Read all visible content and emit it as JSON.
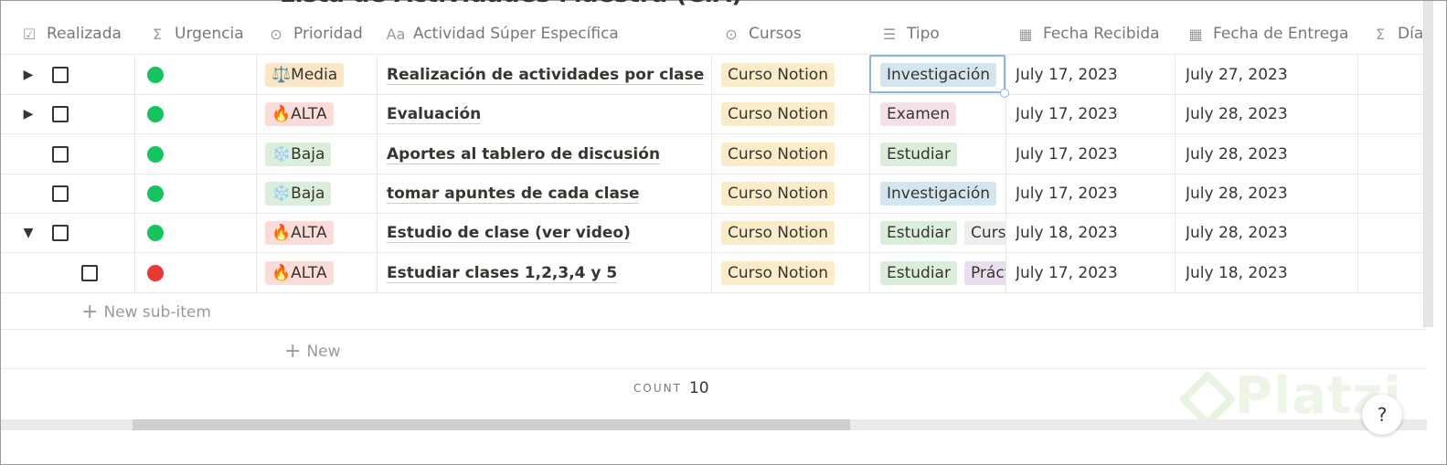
{
  "title": "Lista de Actividades Maestra (C.A)",
  "columns": [
    {
      "label": "Realizada",
      "icon": "☑"
    },
    {
      "label": "Urgencia",
      "icon": "Σ"
    },
    {
      "label": "Prioridad",
      "icon": "⊙"
    },
    {
      "label": "Actividad Súper Específica",
      "icon": "Aa"
    },
    {
      "label": "Cursos",
      "icon": "⊙"
    },
    {
      "label": "Tipo",
      "icon": "☰"
    },
    {
      "label": "Fecha Recibida",
      "icon": "▦"
    },
    {
      "label": "Fecha de Entrega",
      "icon": "▦"
    },
    {
      "label": "Días",
      "icon": "Σ"
    }
  ],
  "rows": [
    {
      "toggle": "▶",
      "urgency": "#16c45f",
      "priority": "⚖️Media",
      "priority_style": "media",
      "activity": "Realización de actividades por clase",
      "course": "Curso Notion",
      "tipo": [
        "Investigación"
      ],
      "received": "July 17, 2023",
      "due": "July 27, 2023"
    },
    {
      "toggle": "▶",
      "urgency": "#16c45f",
      "priority": "🔥ALTA",
      "priority_style": "alta",
      "activity": "Evaluación",
      "course": "Curso Notion",
      "tipo": [
        "Examen"
      ],
      "received": "July 17, 2023",
      "due": "July 28, 2023"
    },
    {
      "toggle": "",
      "urgency": "#16c45f",
      "priority": "❄️Baja",
      "priority_style": "baja",
      "activity": "Aportes al tablero de discusión",
      "course": "Curso Notion",
      "tipo": [
        "Estudiar"
      ],
      "received": "July 17, 2023",
      "due": "July 28, 2023"
    },
    {
      "toggle": "",
      "urgency": "#16c45f",
      "priority": "❄️Baja",
      "priority_style": "baja",
      "activity": "tomar apuntes de cada clase",
      "course": "Curso Notion",
      "tipo": [
        "Investigación"
      ],
      "received": "July 17, 2023",
      "due": "July 28, 2023"
    },
    {
      "toggle": "▼",
      "urgency": "#16c45f",
      "priority": "🔥ALTA",
      "priority_style": "alta",
      "activity": "Estudio de clase (ver video)",
      "course": "Curso Notion",
      "tipo": [
        "Estudiar",
        "Curso"
      ],
      "received": "July 18, 2023",
      "due": "July 28, 2023"
    },
    {
      "toggle": "",
      "urgency": "#e83a34",
      "priority": "🔥ALTA",
      "priority_style": "alta",
      "activity": "Estudiar clases 1,2,3,4 y 5",
      "course": "Curso Notion",
      "tipo": [
        "Estudiar",
        "Práct"
      ],
      "received": "July 17, 2023",
      "due": "July 18, 2023",
      "sub": true
    }
  ],
  "new_subitem": "New sub-item",
  "new_label": "New",
  "count_label": "COUNT",
  "count_value": "10",
  "help_label": "?",
  "watermark": "Platzi",
  "tag_colors": {
    "media": "#fbe7c6",
    "alta": "#fbdcd9",
    "baja": "#dbeddb",
    "Investigación": "#d3e5ef",
    "Examen": "#f5e0e9",
    "Estudiar": "#dbeddb",
    "Curso": "#eeeeed",
    "Práct": "#e8deee",
    "Curso Notion": "#fbecc9"
  }
}
